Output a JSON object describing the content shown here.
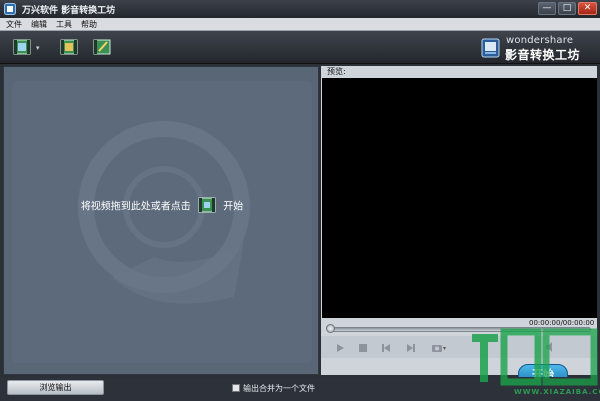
{
  "window": {
    "title": "万兴软件 影音转换工坊",
    "min_label": "—",
    "max_label": "□",
    "close_label": "✕"
  },
  "menu": [
    "文件",
    "编辑",
    "工具",
    "帮助"
  ],
  "toolbar": {
    "dropdown_caret": "▾"
  },
  "brand": {
    "en": "wondershare",
    "cn": "影音转换工坊"
  },
  "drop_hint": {
    "text": "将视频拖到此处或者点击",
    "action": "开始"
  },
  "preview": {
    "label": "预览:",
    "time": "00:00:00/00:00:00",
    "progress": 0
  },
  "start_button": "开始",
  "bottom": {
    "browse_output": "浏览输出",
    "merge_label": "输出合并为一个文件",
    "merge_checked": false
  },
  "watermark": {
    "site": "WWW.XIAZAIBA.COM"
  },
  "colors": {
    "accent": "#1578b6",
    "pane": "#5b6878",
    "video_bg": "#000000"
  }
}
